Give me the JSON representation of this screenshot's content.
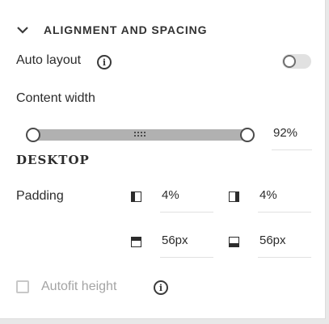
{
  "section": {
    "title": "ALIGNMENT AND SPACING",
    "expanded": true,
    "chevron_icon": "chevron-down-icon"
  },
  "auto_layout": {
    "label": "Auto layout",
    "info_icon": "info-icon",
    "enabled": false
  },
  "content_width": {
    "label": "Content width",
    "value_text": "92%",
    "slider_value": 0.92,
    "grip_icon": "grip-dots-icon"
  },
  "device": {
    "label": "DESKTOP"
  },
  "padding": {
    "label": "Padding",
    "left": {
      "icon": "padding-left-icon",
      "value": "4%"
    },
    "right": {
      "icon": "padding-right-icon",
      "value": "4%"
    },
    "top": {
      "icon": "padding-top-icon",
      "value": "56px"
    },
    "bottom": {
      "icon": "padding-bottom-icon",
      "value": "56px"
    }
  },
  "autofit": {
    "label": "Autofit height",
    "checked": false,
    "disabled": true,
    "info_icon": "info-icon"
  },
  "colors": {
    "text": "#2c2c2c",
    "track": "#b1b1b1",
    "disabled": "#a4a4a4"
  }
}
